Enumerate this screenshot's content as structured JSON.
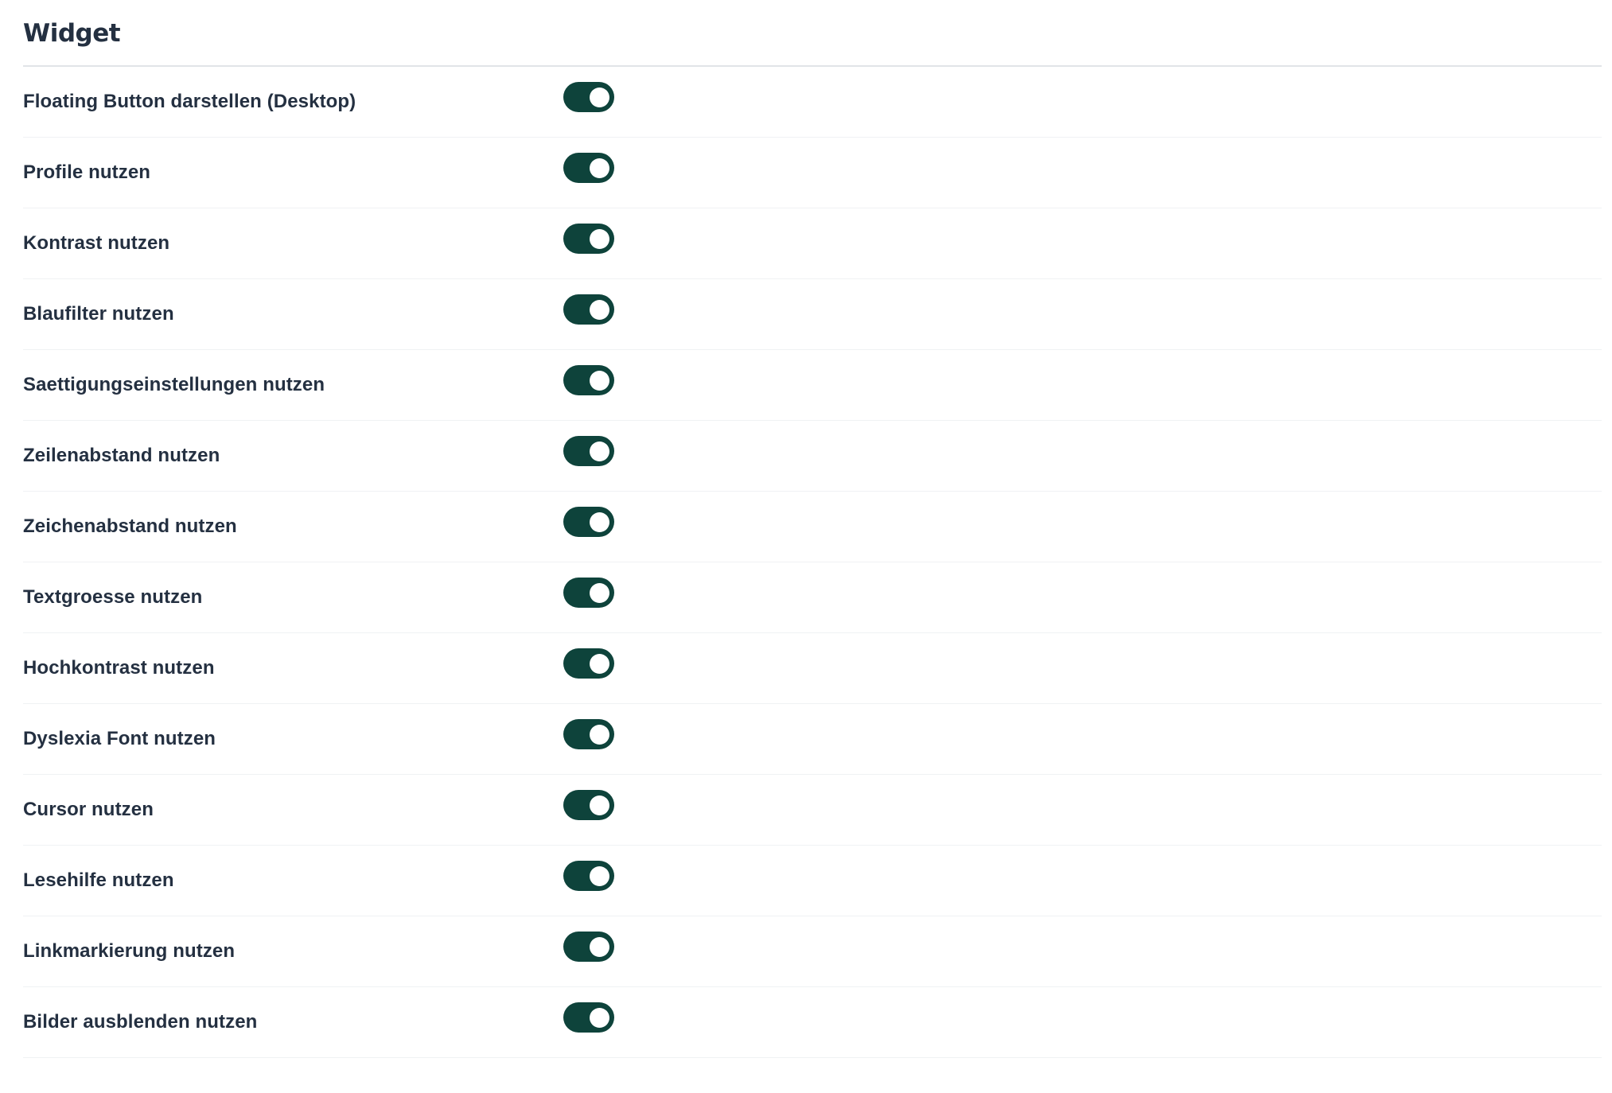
{
  "widget": {
    "title": "Widget",
    "accent_color": "#0e433b",
    "settings": [
      {
        "label": "Floating Button darstellen (Desktop)",
        "enabled": true
      },
      {
        "label": "Profile nutzen",
        "enabled": true
      },
      {
        "label": "Kontrast nutzen",
        "enabled": true
      },
      {
        "label": "Blaufilter nutzen",
        "enabled": true
      },
      {
        "label": "Saettigungseinstellungen nutzen",
        "enabled": true
      },
      {
        "label": "Zeilenabstand nutzen",
        "enabled": true
      },
      {
        "label": "Zeichenabstand nutzen",
        "enabled": true
      },
      {
        "label": "Textgroesse nutzen",
        "enabled": true
      },
      {
        "label": "Hochkontrast nutzen",
        "enabled": true
      },
      {
        "label": "Dyslexia Font nutzen",
        "enabled": true
      },
      {
        "label": "Cursor nutzen",
        "enabled": true
      },
      {
        "label": "Lesehilfe nutzen",
        "enabled": true
      },
      {
        "label": "Linkmarkierung nutzen",
        "enabled": true
      },
      {
        "label": "Bilder ausblenden nutzen",
        "enabled": true
      }
    ]
  }
}
